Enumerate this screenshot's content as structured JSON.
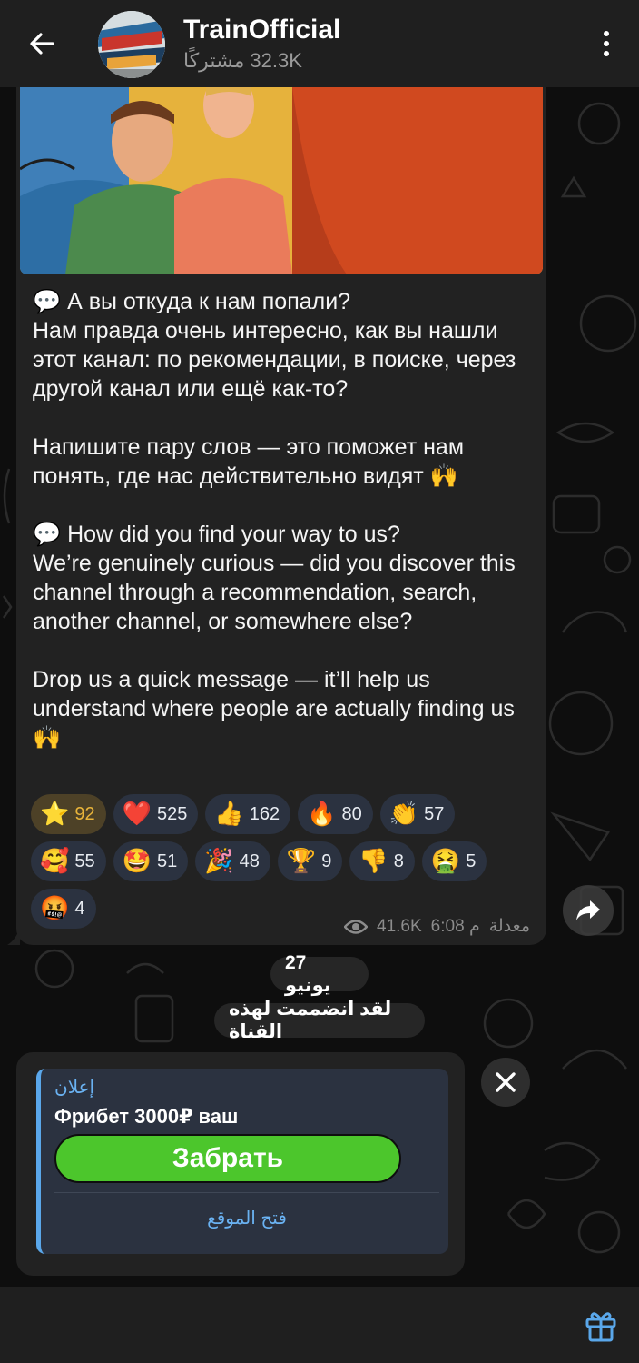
{
  "header": {
    "title": "TrainOfficial",
    "subscribers_count": "32.3K",
    "subscribers_label": "مشتركًا"
  },
  "post": {
    "text": "💬 А вы откуда к нам попали?\nНам правда очень интересно, как вы нашли этот канал: по рекомендации, в поиске, через другой канал или ещё как-то?\n\nНапишите пару слов — это поможет нам понять, где нас действительно видят 🙌\n\n💬 How did you find your way to us?\nWe’re genuinely curious — did you discover this channel through a recommendation, search, another channel, or somewhere else?\n\nDrop us a quick message — it’ll help us understand where people are actually finding us 🙌",
    "reactions": [
      {
        "emoji": "⭐",
        "count": "92",
        "active": true
      },
      {
        "emoji": "❤️",
        "count": "525"
      },
      {
        "emoji": "👍",
        "count": "162"
      },
      {
        "emoji": "🔥",
        "count": "80"
      },
      {
        "emoji": "👏",
        "count": "57"
      },
      {
        "emoji": "🥰",
        "count": "55"
      },
      {
        "emoji": "🤩",
        "count": "51"
      },
      {
        "emoji": "🎉",
        "count": "48"
      },
      {
        "emoji": "🏆",
        "count": "9"
      },
      {
        "emoji": "👎",
        "count": "8"
      },
      {
        "emoji": "🤮",
        "count": "5"
      },
      {
        "emoji": "🤬",
        "count": "4"
      }
    ],
    "views": "41.6K",
    "time": "6:08 م",
    "edited_label": "معدلة"
  },
  "service": {
    "date": "27 يونيو",
    "joined": "لقد انضممت لهذه القناة"
  },
  "ad": {
    "label": "إعلان",
    "text": "Фрибет 3000₽ ваш",
    "button": "Забрать",
    "link": "فتح الموقع"
  },
  "colors": {
    "accent": "#6ab2f2",
    "cta": "#4cc62c",
    "star_reaction": "#e9b43a",
    "bubble": "#222222",
    "header": "#1f1f1f"
  },
  "icons": {
    "back": "arrow-left-icon",
    "more": "more-vertical-icon",
    "views": "eye-icon",
    "share": "share-icon",
    "close": "close-icon",
    "gift": "gift-icon"
  }
}
